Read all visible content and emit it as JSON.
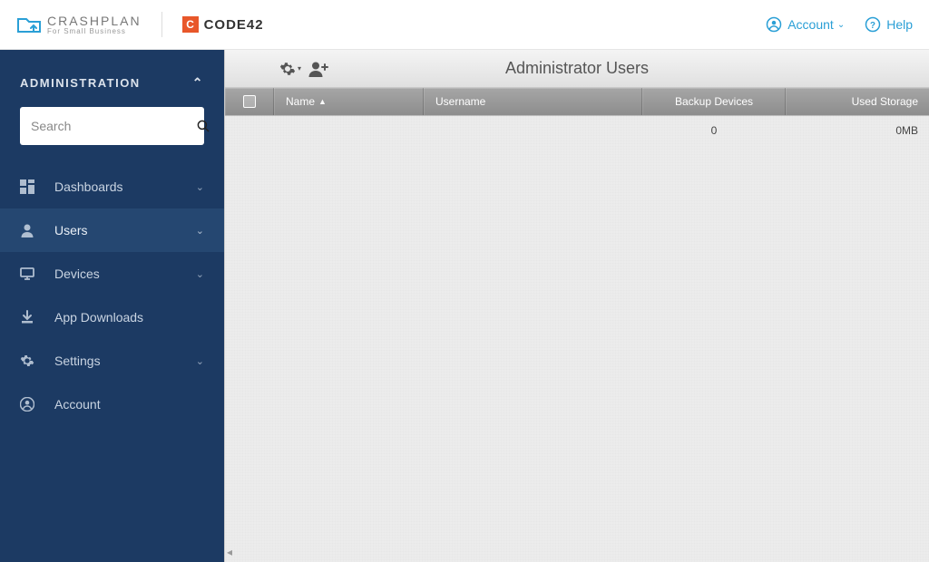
{
  "top": {
    "brand1_main": "CRASHPLAN",
    "brand1_sub": "For Small Business",
    "brand2": "CODE42",
    "account_label": "Account",
    "help_label": "Help"
  },
  "sidebar": {
    "header": "ADMINISTRATION",
    "search_placeholder": "Search",
    "items": [
      {
        "label": "Dashboards",
        "has_chevron": true
      },
      {
        "label": "Users",
        "has_chevron": true
      },
      {
        "label": "Devices",
        "has_chevron": true
      },
      {
        "label": "App Downloads",
        "has_chevron": false
      },
      {
        "label": "Settings",
        "has_chevron": true
      },
      {
        "label": "Account",
        "has_chevron": false
      }
    ]
  },
  "main": {
    "title": "Administrator Users",
    "columns": {
      "name": "Name",
      "username": "Username",
      "backup": "Backup Devices",
      "storage": "Used Storage"
    },
    "row": {
      "backup_devices": "0",
      "used_storage": "0MB"
    }
  }
}
